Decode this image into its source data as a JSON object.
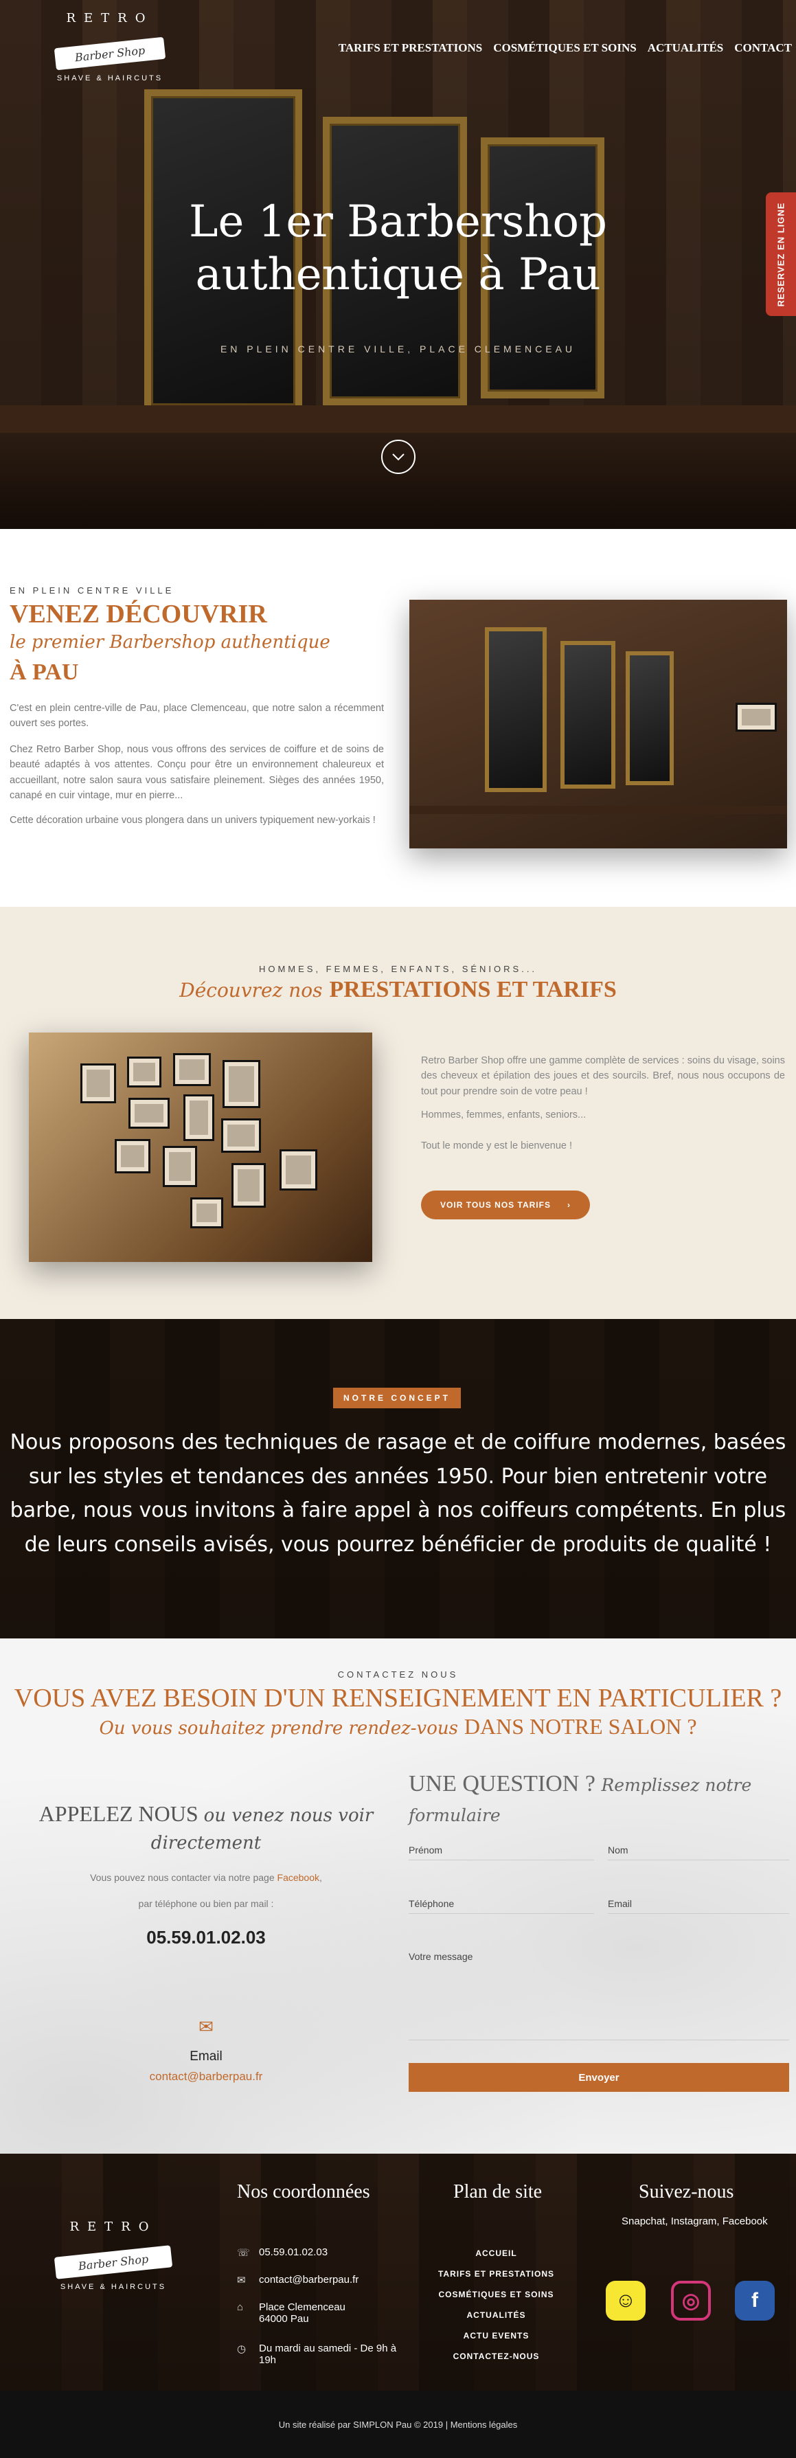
{
  "nav": {
    "items": [
      "TARIFS ET PRESTATIONS",
      "COSMÉTIQUES ET SOINS",
      "ACTUALITÉS",
      "CONTACT"
    ]
  },
  "logo": {
    "top": "RETRO",
    "banner": "Barber Shop",
    "sub": "SHAVE & HAIRCUTS"
  },
  "hero": {
    "title_line1": "Le 1er Barbershop",
    "title_line2": "authentique à Pau",
    "tagline": "EN PLEIN CENTRE VILLE, PLACE CLEMENCEAU",
    "down_icon": "chevron-down-icon"
  },
  "reserve": {
    "label": "RESERVEZ EN LIGNE"
  },
  "discover": {
    "eyebrow": "EN PLEIN CENTRE VILLE",
    "title": "VENEZ DÉCOUVRIR",
    "subtitle": "le premier Barbershop authentique",
    "place": "À PAU",
    "p1": "C'est en plein centre-ville de Pau, place Clemenceau, que notre salon a récemment ouvert ses portes.",
    "p2": "Chez Retro Barber Shop, nous vous offrons des services de coiffure et de soins de beauté adaptés à vos attentes. Conçu pour être un environnement chaleureux et accueillant, notre salon saura vous satisfaire pleinement. Sièges des années 1950, canapé en cuir vintage, mur en pierre...",
    "p3": "Cette décoration urbaine vous plongera dans un univers typiquement new-yorkais !"
  },
  "presta": {
    "eyebrow": "HOMMES, FEMMES, ENFANTS, SÉNIORS...",
    "title_italic": "Découvrez nos",
    "title_bold": "PRESTATIONS ET TARIFS",
    "p1": "Retro Barber Shop offre une gamme complète de services : soins du visage, soins des cheveux et épilation des joues et des sourcils. Bref, nous nous occupons de tout pour prendre soin de votre peau !",
    "p2": "Hommes, femmes, enfants, seniors...",
    "p3": "Tout le monde y est le bienvenue !",
    "button": "VOIR TOUS NOS TARIFS",
    "button_icon": "arrow-icon"
  },
  "concept": {
    "badge": "NOTRE CONCEPT",
    "text": "Nous proposons des techniques de rasage et de coiffure modernes, basées sur les styles et tendances des années 1950. Pour bien entretenir votre barbe, nous vous invitons à faire appel à nos coiffeurs compétents. En plus de leurs conseils avisés, vous pourrez bénéficier de produits de qualité !"
  },
  "contact": {
    "eyebrow": "CONTACTEZ NOUS",
    "title1": "VOUS AVEZ BESOIN D'UN RENSEIGNEMENT EN PARTICULIER ?",
    "title2_italic": "Ou vous souhaitez prendre rendez-vous",
    "title2_upper": "DANS NOTRE SALON ?",
    "call_upper": "APPELEZ NOUS",
    "call_italic": "ou venez nous voir directement",
    "fb_text": "Vous pouvez nous contacter via notre page",
    "fb_link": "Facebook",
    "fb_end": ",",
    "phone_text": "par téléphone ou bien par mail :",
    "phone": "05.59.01.02.03",
    "mail_icon": "mail-icon",
    "email_label": "Email",
    "email": "contact@barberpau.fr",
    "form_upper": "UNE QUESTION ?",
    "form_italic": "Remplissez notre formulaire",
    "fields": {
      "firstname": "Prénom",
      "lastname": "Nom",
      "phone": "Téléphone",
      "email": "Email",
      "message": "Votre message"
    },
    "send": "Envoyer"
  },
  "footer": {
    "coord_title": "Nos coordonnées",
    "phone": "05.59.01.02.03",
    "email": "contact@barberpau.fr",
    "address1": "Place Clemenceau",
    "address2": "64000 Pau",
    "hours1": "Du mardi au samedi - De 9h à",
    "hours2": "19h",
    "sitemap_title": "Plan de site",
    "sitemap": [
      "ACCUEIL",
      "TARIFS ET PRESTATIONS",
      "COSMÉTIQUES ET SOINS",
      "ACTUALITÉS",
      "ACTU EVENTS",
      "CONTACTEZ-NOUS"
    ],
    "follow_title": "Suivez-nous",
    "follow_sub": "Snapchat, Instagram, Facebook",
    "bottom": "Un site réalisé par SIMPLON Pau © 2019 | Mentions légales"
  }
}
